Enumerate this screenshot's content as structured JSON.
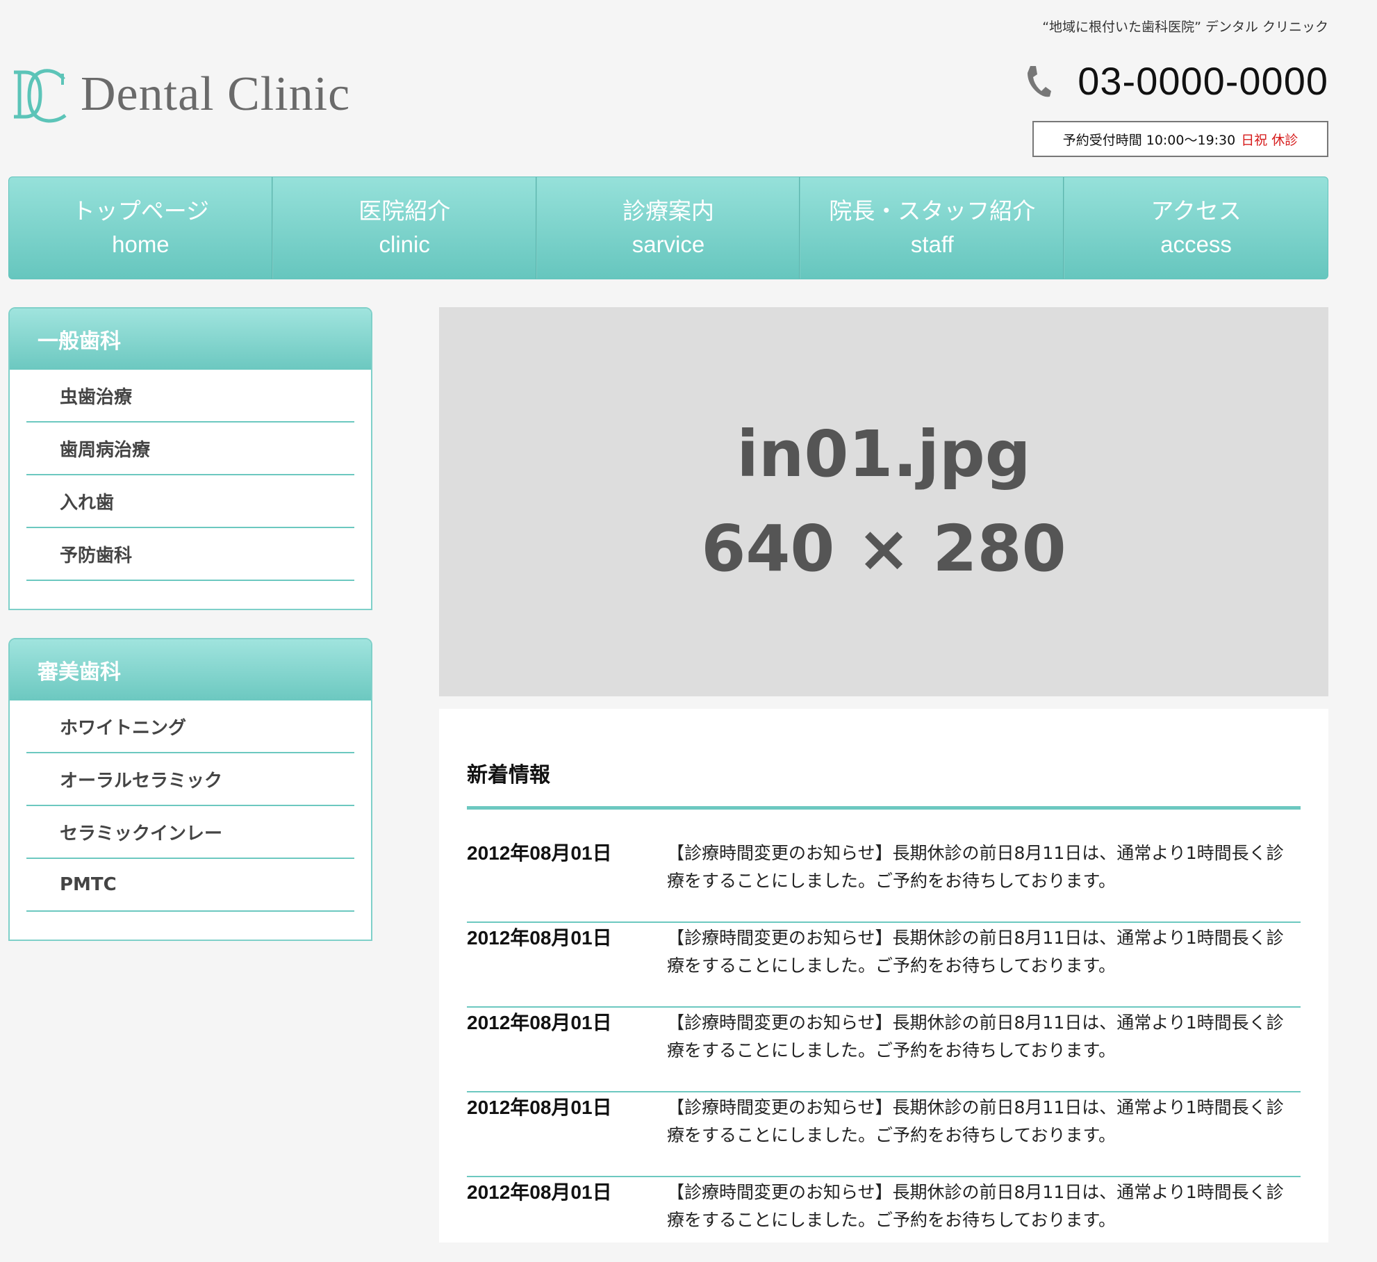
{
  "header": {
    "logo_text": "Dental Clinic",
    "tagline": "“地域に根付いた歯科医院” デンタル クリニック",
    "phone": "03-0000-0000",
    "hours_label": "予約受付時間 10:00〜19:30",
    "hours_closed": "日祝 休診"
  },
  "nav": [
    {
      "jp": "トップページ",
      "en": "home"
    },
    {
      "jp": "医院紹介",
      "en": "clinic"
    },
    {
      "jp": "診療案内",
      "en": "sarvice"
    },
    {
      "jp": "院長・スタッフ紹介",
      "en": "staff"
    },
    {
      "jp": "アクセス",
      "en": "access"
    }
  ],
  "sidebar": {
    "general": {
      "title": "一般歯科",
      "items": [
        "虫歯治療",
        "歯周病治療",
        "入れ歯",
        "予防歯科"
      ]
    },
    "cosmetic": {
      "title": "審美歯科",
      "items": [
        "ホワイトニング",
        "オーラルセラミック",
        "セラミックインレー",
        "PMTC"
      ]
    }
  },
  "hero": {
    "line1": "in01.jpg",
    "line2": "640 × 280"
  },
  "news": {
    "title": "新着情報",
    "items": [
      {
        "date": "2012年08月01日",
        "text": "【診療時間変更のお知らせ】長期休診の前日8月11日は、通常より1時間長く診療をすることにしました。ご予約をお待ちしております。"
      },
      {
        "date": "2012年08月01日",
        "text": "【診療時間変更のお知らせ】長期休診の前日8月11日は、通常より1時間長く診療をすることにしました。ご予約をお待ちしております。"
      },
      {
        "date": "2012年08月01日",
        "text": "【診療時間変更のお知らせ】長期休診の前日8月11日は、通常より1時間長く診療をすることにしました。ご予約をお待ちしております。"
      },
      {
        "date": "2012年08月01日",
        "text": "【診療時間変更のお知らせ】長期休診の前日8月11日は、通常より1時間長く診療をすることにしました。ご予約をお待ちしております。"
      },
      {
        "date": "2012年08月01日",
        "text": "【診療時間変更のお知らせ】長期休診の前日8月11日は、通常より1時間長く診療をすることにしました。ご予約をお待ちしております。"
      }
    ]
  },
  "colors": {
    "accent": "#6cc8c0",
    "closed_red": "#d61a1a"
  },
  "icons": [
    "dc-logo-icon",
    "phone-icon"
  ]
}
